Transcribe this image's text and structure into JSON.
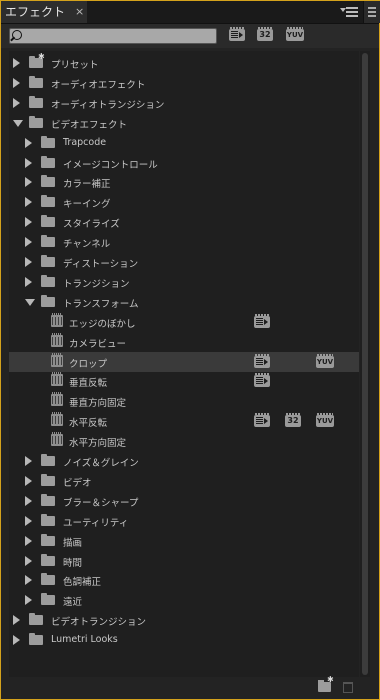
{
  "tab": {
    "title": "エフェクト",
    "close": "×"
  },
  "search": {
    "value": "",
    "placeholder": ""
  },
  "filters": {
    "accelerated": "accelerated-effects-icon",
    "b32": "32",
    "yuv": "YUV"
  },
  "tree": [
    {
      "label": "プリセット",
      "level": 0,
      "kind": "folder",
      "state": "closed",
      "star": true
    },
    {
      "label": "オーディオエフェクト",
      "level": 0,
      "kind": "folder",
      "state": "closed"
    },
    {
      "label": "オーディオトランジション",
      "level": 0,
      "kind": "folder",
      "state": "closed"
    },
    {
      "label": "ビデオエフェクト",
      "level": 0,
      "kind": "folder",
      "state": "open"
    },
    {
      "label": "Trapcode",
      "level": 1,
      "kind": "folder",
      "state": "closed"
    },
    {
      "label": "イメージコントロール",
      "level": 1,
      "kind": "folder",
      "state": "closed"
    },
    {
      "label": "カラー補正",
      "level": 1,
      "kind": "folder",
      "state": "closed"
    },
    {
      "label": "キーイング",
      "level": 1,
      "kind": "folder",
      "state": "closed"
    },
    {
      "label": "スタイライズ",
      "level": 1,
      "kind": "folder",
      "state": "closed"
    },
    {
      "label": "チャンネル",
      "level": 1,
      "kind": "folder",
      "state": "closed"
    },
    {
      "label": "ディストーション",
      "level": 1,
      "kind": "folder",
      "state": "closed"
    },
    {
      "label": "トランジション",
      "level": 1,
      "kind": "folder",
      "state": "closed"
    },
    {
      "label": "トランスフォーム",
      "level": 1,
      "kind": "folder",
      "state": "open"
    },
    {
      "label": "エッジのぼかし",
      "level": 2,
      "kind": "effect",
      "acc": true
    },
    {
      "label": "カメラビュー",
      "level": 2,
      "kind": "effect"
    },
    {
      "label": "クロップ",
      "level": 2,
      "kind": "effect",
      "acc": true,
      "yuv": true,
      "selected": true
    },
    {
      "label": "垂直反転",
      "level": 2,
      "kind": "effect",
      "acc": true
    },
    {
      "label": "垂直方向固定",
      "level": 2,
      "kind": "effect"
    },
    {
      "label": "水平反転",
      "level": 2,
      "kind": "effect",
      "acc": true,
      "b32": true,
      "yuv": true
    },
    {
      "label": "水平方向固定",
      "level": 2,
      "kind": "effect"
    },
    {
      "label": "ノイズ＆グレイン",
      "level": 1,
      "kind": "folder",
      "state": "closed"
    },
    {
      "label": "ビデオ",
      "level": 1,
      "kind": "folder",
      "state": "closed"
    },
    {
      "label": "ブラー＆シャープ",
      "level": 1,
      "kind": "folder",
      "state": "closed"
    },
    {
      "label": "ユーティリティ",
      "level": 1,
      "kind": "folder",
      "state": "closed"
    },
    {
      "label": "描画",
      "level": 1,
      "kind": "folder",
      "state": "closed"
    },
    {
      "label": "時間",
      "level": 1,
      "kind": "folder",
      "state": "closed"
    },
    {
      "label": "色調補正",
      "level": 1,
      "kind": "folder",
      "state": "closed"
    },
    {
      "label": "遠近",
      "level": 1,
      "kind": "folder",
      "state": "closed"
    },
    {
      "label": "ビデオトランジション",
      "level": 0,
      "kind": "folder",
      "state": "closed"
    },
    {
      "label": "Lumetri Looks",
      "level": 0,
      "kind": "folder",
      "state": "closed"
    }
  ],
  "footer": {
    "new_bin": "new-custom-bin-icon",
    "delete": "trash-icon"
  },
  "colors": {
    "accent_border": "#d4a21c",
    "background": "#232323",
    "selected_row": "#3a3a3a"
  }
}
